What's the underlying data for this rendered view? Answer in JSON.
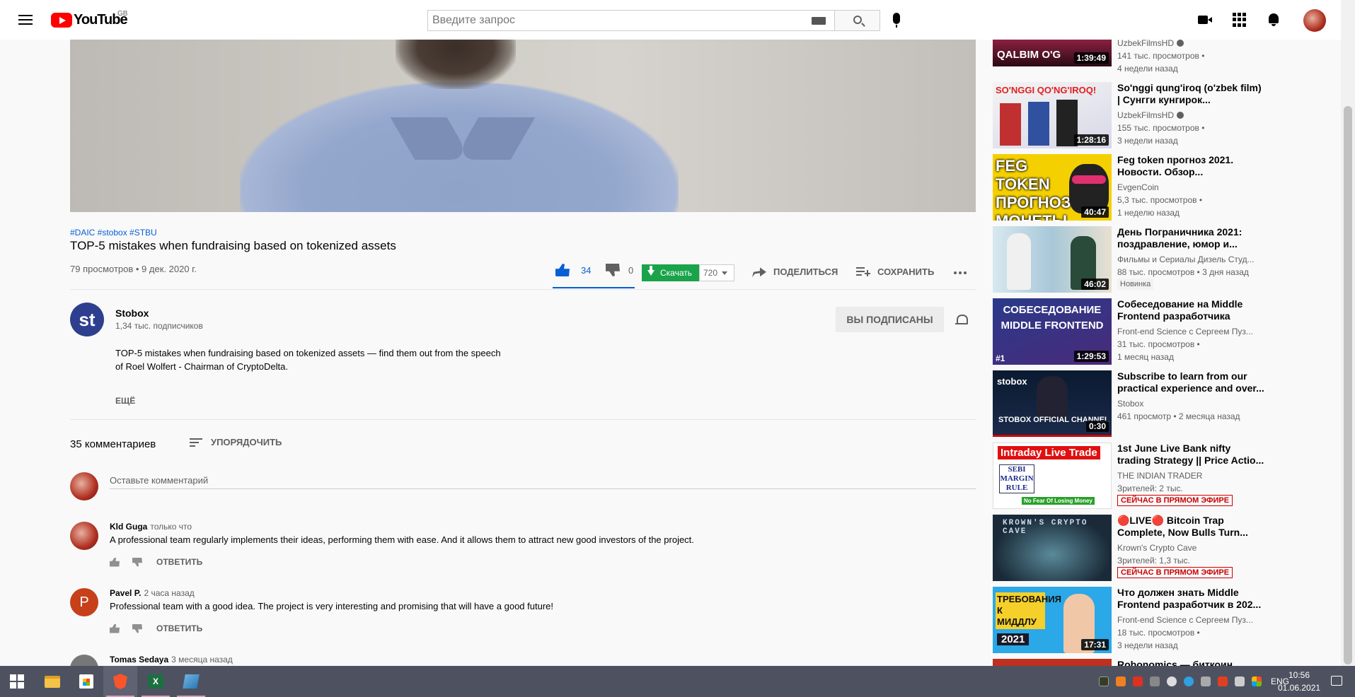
{
  "header": {
    "logo_text": "YouTube",
    "region": "GB",
    "search_placeholder": "Введите запрос"
  },
  "video": {
    "hashtags": "#DAIC #stobox #STBU",
    "title": "TOP-5 mistakes when fundraising based on tokenized assets",
    "views_date": "79 просмотров • 9 дек. 2020 г.",
    "likes": "34",
    "dislikes": "0",
    "download_label": "Скачать",
    "quality": "720",
    "share_label": "ПОДЕЛИТЬСЯ",
    "save_label": "СОХРАНИТЬ"
  },
  "channel": {
    "avatar_text": "st",
    "name": "Stobox",
    "subscribers": "1,34 тыс. подписчиков",
    "subscribed_label": "ВЫ ПОДПИСАНЫ",
    "description_line1": "TOP-5 mistakes when fundraising based on tokenized assets — find them out from the speech",
    "description_line2": "of Roel Wolfert - Chairman of CryptoDelta.",
    "more_label": "ЕЩЁ"
  },
  "comments": {
    "count": "35 комментариев",
    "sort_label": "УПОРЯДОЧИТЬ",
    "input_placeholder": "Оставьте комментарий",
    "reply_label": "ОТВЕТИТЬ",
    "items": [
      {
        "author": "Kld Guga",
        "time": "только что",
        "text": "A professional team regularly implements their ideas, performing them with ease. And it allows them to attract new good investors of the project.",
        "avatar_letter": ""
      },
      {
        "author": "Pavel P.",
        "time": "2 часа назад",
        "text": "Professional team with a good idea. The project is very interesting and promising that will have a good future!",
        "avatar_letter": "P"
      },
      {
        "author": "Tomas Sedaya",
        "time": "3 месяца назад",
        "text": "",
        "avatar_letter": ""
      }
    ]
  },
  "sidebar": {
    "items": [
      {
        "title": "",
        "channel": "UzbekFilmsHD",
        "meta": "141 тыс. просмотров •",
        "meta2": "4 недели назад",
        "duration": "1:39:49",
        "thumb_text": "QALBIM O'G"
      },
      {
        "title": "So'nggi qung'iroq (o'zbek film) | Сунгги кунгирок...",
        "channel": "UzbekFilmsHD",
        "meta": "155 тыс. просмотров •",
        "meta2": "3 недели назад",
        "duration": "1:28:16",
        "thumb_text": "SO'NGGI QO'NG'IROQ!"
      },
      {
        "title": "Feg token прогноз 2021. Новости. Обзор...",
        "channel": "EvgenCoin",
        "meta": "5,3 тыс. просмотров •",
        "meta2": "1 неделю назад",
        "duration": "40:47",
        "thumb_text": "FEG TOKEN ПРОГНОЗ МОНЕТЫ"
      },
      {
        "title": "День Пограничника 2021: поздравление, юмор и...",
        "channel": "Фильмы и Сериалы Дизель Студ...",
        "meta": "88 тыс. просмотров • 3 дня назад",
        "badge": "Новинка",
        "duration": "46:02"
      },
      {
        "title": "Собеседование на Middle Frontend разработчика",
        "channel": "Front-end Science с Сергеем Пуз...",
        "meta": "31 тыс. просмотров •",
        "meta2": "1 месяц назад",
        "duration": "1:29:53",
        "thumb_text": "СОБЕСЕДОВАНИЕ MIDDLE FRONTEND",
        "rank": "#1"
      },
      {
        "title": "Subscribe to learn from our practical experience and over...",
        "channel": "Stobox",
        "meta": "461 просмотр • 2 месяца назад",
        "duration": "0:30",
        "thumb_text": "STOBOX OFFICIAL CHANNEL",
        "thumb_logo": "stobox"
      },
      {
        "title": "1st June Live Bank nifty trading Strategy || Price Actio...",
        "channel": "THE INDIAN TRADER",
        "meta": "Зрителей: 2 тыс.",
        "live": "СЕЙЧАС В ПРЯМОМ ЭФИРЕ",
        "thumb_text": "Intraday Live Trade",
        "thumb_text2": "SEBI MARGIN RULE",
        "thumb_text3": "No Fear Of Losing Money"
      },
      {
        "title": "🔴LIVE🔴 Bitcoin Trap Complete, Now Bulls Turn...",
        "channel": "Krown's Crypto Cave",
        "meta": "Зрителей: 1,3 тыс.",
        "live": "СЕЙЧАС В ПРЯМОМ ЭФИРЕ",
        "thumb_text": "KROWN'S CRYPTO CAVE"
      },
      {
        "title": "Что должен знать Middle Frontend разработчик в 202...",
        "channel": "Front-end Science с Сергеем Пуз...",
        "meta": "18 тыс. просмотров •",
        "meta2": "3 недели назад",
        "duration": "17:31",
        "thumb_text": "ТРЕБОВАНИЯ К МИДДЛУ",
        "thumb_text2": "2021"
      },
      {
        "title": "Robonomics — биткоин..."
      }
    ]
  },
  "taskbar": {
    "excel_letter": "X",
    "lang": "ENG",
    "time": "10:56",
    "date": "01.06.2021"
  }
}
